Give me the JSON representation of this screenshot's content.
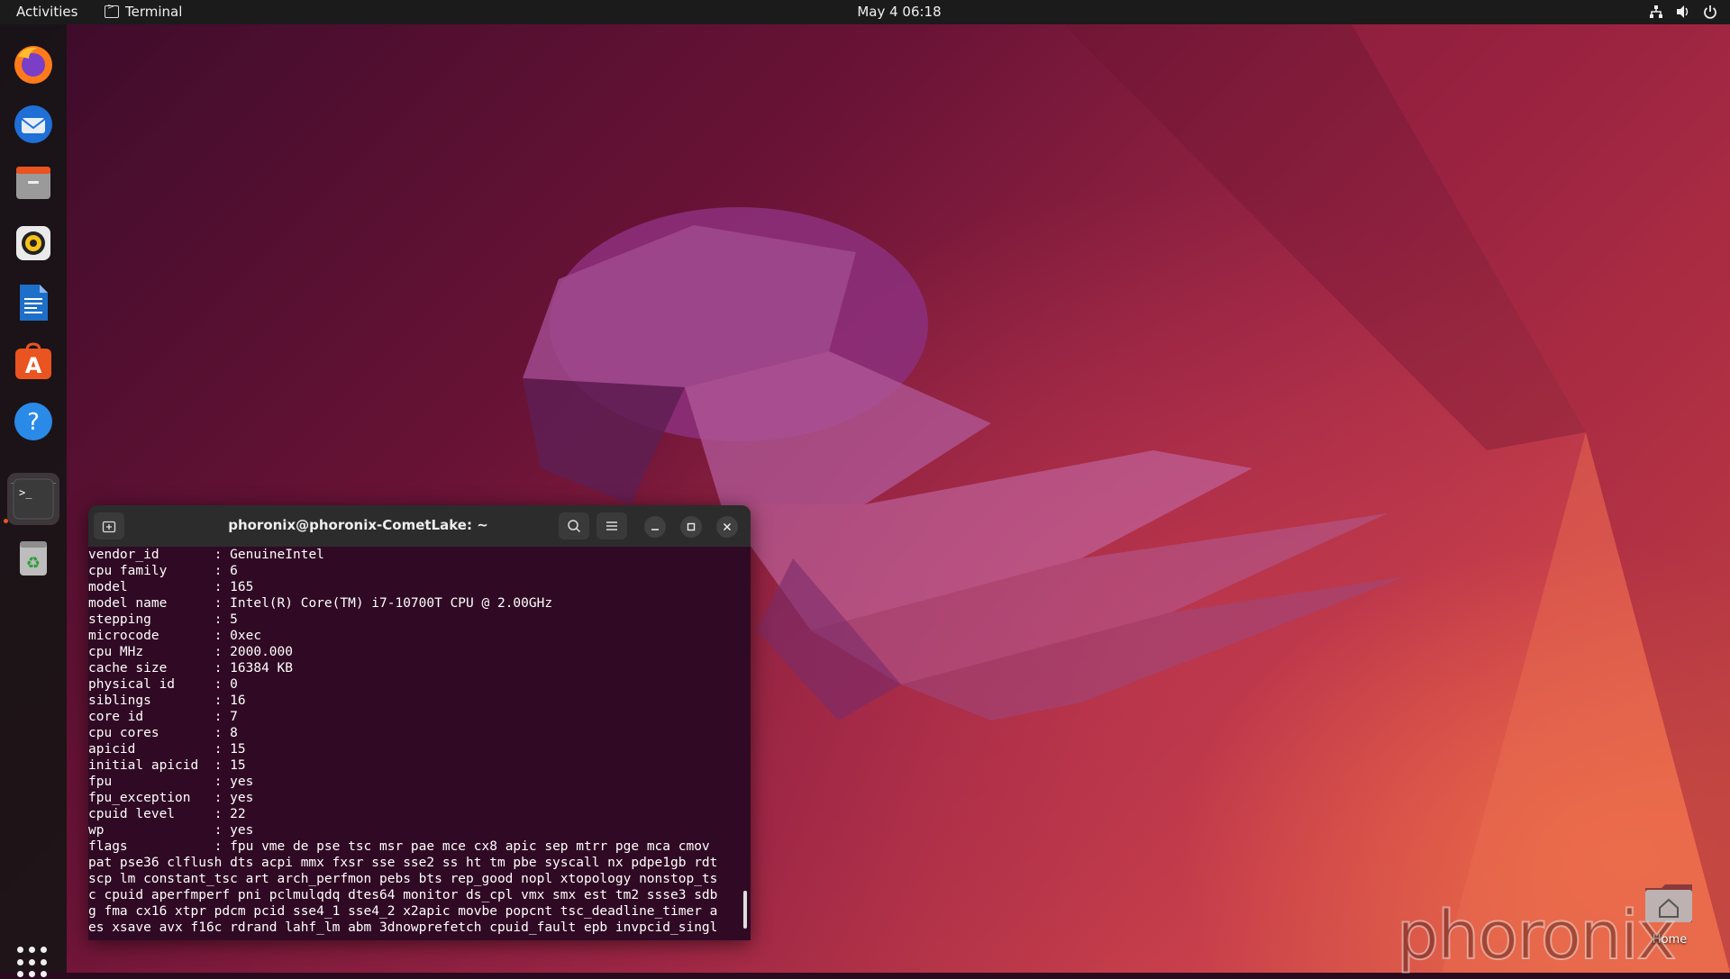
{
  "topbar": {
    "activities": "Activities",
    "app_name": "Terminal",
    "clock": "May 4  06:18",
    "tray_icons": [
      "network-icon",
      "volume-icon",
      "power-icon"
    ]
  },
  "dock": {
    "items": [
      {
        "name": "firefox-icon"
      },
      {
        "name": "thunderbird-icon"
      },
      {
        "name": "files-icon"
      },
      {
        "name": "rhythmbox-icon"
      },
      {
        "name": "libreoffice-writer-icon"
      },
      {
        "name": "ubuntu-software-icon"
      },
      {
        "name": "help-icon"
      },
      {
        "name": "terminal-icon"
      },
      {
        "name": "trash-icon"
      }
    ],
    "show_apps": "show-applications-icon"
  },
  "terminal": {
    "title": "phoronix@phoronix-CometLake: ~",
    "lines": [
      "vendor_id\t: GenuineIntel",
      "cpu family\t: 6",
      "model\t\t: 165",
      "model name\t: Intel(R) Core(TM) i7-10700T CPU @ 2.00GHz",
      "stepping\t: 5",
      "microcode\t: 0xec",
      "cpu MHz\t\t: 2000.000",
      "cache size\t: 16384 KB",
      "physical id\t: 0",
      "siblings\t: 16",
      "core id\t\t: 7",
      "cpu cores\t: 8",
      "apicid\t\t: 15",
      "initial apicid\t: 15",
      "fpu\t\t: yes",
      "fpu_exception\t: yes",
      "cpuid level\t: 22",
      "wp\t\t: yes",
      "flags\t\t: fpu vme de pse tsc msr pae mce cx8 apic sep mtrr pge mca cmov",
      "pat pse36 clflush dts acpi mmx fxsr sse sse2 ss ht tm pbe syscall nx pdpe1gb rdt",
      "scp lm constant_tsc art arch_perfmon pebs bts rep_good nopl xtopology nonstop_ts",
      "c cpuid aperfmperf pni pclmulqdq dtes64 monitor ds_cpl vmx smx est tm2 ssse3 sdb",
      "g fma cx16 xtpr pdcm pcid sse4_1 sse4_2 x2apic movbe popcnt tsc_deadline_timer a",
      "es xsave avx f16c rdrand lahf_lm abm 3dnowprefetch cpuid_fault epb invpcid_singl"
    ]
  },
  "desktop": {
    "home_label": "Home",
    "watermark": "phoronix"
  },
  "colors": {
    "terminal_bg": "#300a24",
    "accent": "#e95420"
  }
}
